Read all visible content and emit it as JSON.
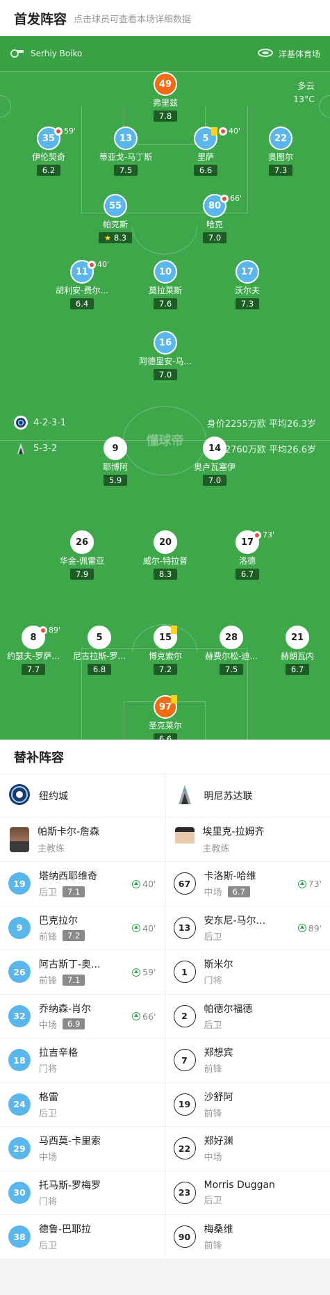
{
  "header": {
    "title": "首发阵容",
    "subtitle": "点击球员可查看本场详细数据"
  },
  "match": {
    "referee": "Serhiy Boiko",
    "stadium": "洋基体育场",
    "weather": "多云",
    "temp": "13°C",
    "watermark": "懂球帝"
  },
  "home_info": {
    "formation": "4-2-3-1",
    "value": "身价2255万欧 平均26.3岁"
  },
  "away_info": {
    "formation": "5-3-2",
    "value": "身价2760万欧 平均26.6岁"
  },
  "home_players": [
    {
      "num": "49",
      "name": "弗里兹",
      "rating": "7.8",
      "color": "orange"
    },
    {
      "num": "35",
      "name": "伊伦契奇",
      "rating": "6.2",
      "sub": "59'"
    },
    {
      "num": "13",
      "name": "蒂亚戈-马丁斯",
      "rating": "7.5",
      "captain": "C"
    },
    {
      "num": "5",
      "name": "里萨",
      "rating": "6.6",
      "sub": "40'",
      "card": "yellow"
    },
    {
      "num": "22",
      "name": "奥图尔",
      "rating": "7.3"
    },
    {
      "num": "55",
      "name": "帕克斯",
      "rating": "8.3",
      "goal": true,
      "best": true
    },
    {
      "num": "80",
      "name": "哈克",
      "rating": "7.0",
      "sub": "66'"
    },
    {
      "num": "11",
      "name": "胡利安-费尔...",
      "rating": "6.4",
      "sub": "40'"
    },
    {
      "num": "10",
      "name": "莫拉莱斯",
      "rating": "7.6"
    },
    {
      "num": "17",
      "name": "沃尔夫",
      "rating": "7.3"
    },
    {
      "num": "16",
      "name": "阿德里安-马...",
      "rating": "7.0"
    }
  ],
  "away_players": [
    {
      "num": "9",
      "name": "耶博阿",
      "rating": "5.9"
    },
    {
      "num": "14",
      "name": "奥卢瓦塞伊",
      "rating": "7.0",
      "goal": true
    },
    {
      "num": "26",
      "name": "华金-佩雷亚",
      "rating": "7.9",
      "assists": true
    },
    {
      "num": "20",
      "name": "威尔-特拉普",
      "rating": "8.3",
      "goal": true
    },
    {
      "num": "17",
      "name": "洛德",
      "rating": "6.7",
      "sub": "73'"
    },
    {
      "num": "8",
      "name": "约瑟夫-罗萨...",
      "rating": "7.7",
      "sub": "89'"
    },
    {
      "num": "5",
      "name": "尼古拉斯-罗...",
      "rating": "6.8"
    },
    {
      "num": "15",
      "name": "博克索尔",
      "rating": "7.2",
      "captain": "C",
      "card": "yellow"
    },
    {
      "num": "28",
      "name": "赫费尔松-迪...",
      "rating": "7.5"
    },
    {
      "num": "21",
      "name": "赫朗瓦内",
      "rating": "6.7"
    },
    {
      "num": "97",
      "name": "圣克莱尔",
      "rating": "6.6",
      "color": "orange",
      "card": "yellow"
    }
  ],
  "subs": {
    "title": "替补阵容",
    "home_team": "纽约城",
    "away_team": "明尼苏达联",
    "home_coach": {
      "name": "帕斯卡尔-詹森",
      "role": "主教练"
    },
    "away_coach": {
      "name": "埃里克-拉姆齐",
      "role": "主教练"
    },
    "home": [
      {
        "num": "19",
        "name": "塔纳西耶维奇",
        "pos": "后卫",
        "rating": "7.1",
        "on": "40'"
      },
      {
        "num": "9",
        "name": "巴克拉尔",
        "pos": "前锋",
        "rating": "7.2",
        "on": "40'"
      },
      {
        "num": "26",
        "name": "阿古斯丁-奥...",
        "pos": "前锋",
        "rating": "7.1",
        "on": "59'"
      },
      {
        "num": "32",
        "name": "乔纳森-肖尔",
        "pos": "中场",
        "rating": "6.9",
        "on": "66'"
      },
      {
        "num": "18",
        "name": "拉吉辛格",
        "pos": "门将"
      },
      {
        "num": "24",
        "name": "格雷",
        "pos": "后卫"
      },
      {
        "num": "29",
        "name": "马西莫-卡里索",
        "pos": "中场"
      },
      {
        "num": "30",
        "name": "托马斯-罗梅罗",
        "pos": "门将"
      },
      {
        "num": "38",
        "name": "德鲁-巴耶拉",
        "pos": "后卫"
      }
    ],
    "away": [
      {
        "num": "67",
        "name": "卡洛斯-哈维",
        "pos": "中场",
        "rating": "6.7",
        "on": "73'"
      },
      {
        "num": "13",
        "name": "安东尼-马尔...",
        "pos": "后卫",
        "on": "89'"
      },
      {
        "num": "1",
        "name": "斯米尔",
        "pos": "门将"
      },
      {
        "num": "2",
        "name": "帕德尔福德",
        "pos": "后卫"
      },
      {
        "num": "7",
        "name": "郑想宾",
        "pos": "前锋"
      },
      {
        "num": "19",
        "name": "沙舒阿",
        "pos": "前锋"
      },
      {
        "num": "22",
        "name": "郑好渊",
        "pos": "中场"
      },
      {
        "num": "23",
        "name": "Morris Duggan",
        "pos": "后卫"
      },
      {
        "num": "90",
        "name": "梅桑维",
        "pos": "前锋"
      }
    ]
  }
}
